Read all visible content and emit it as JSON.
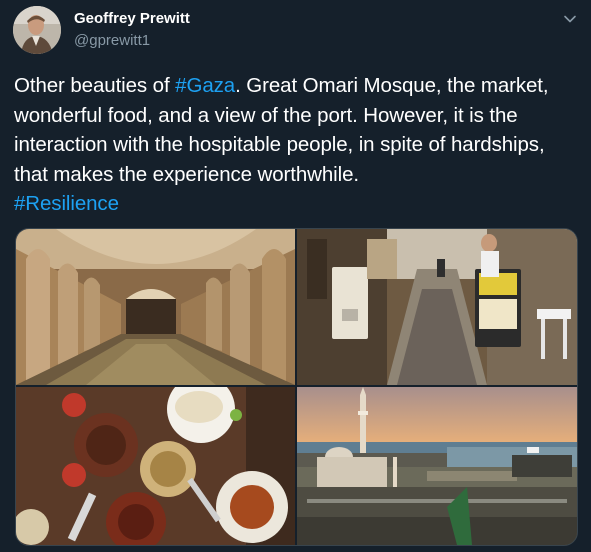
{
  "tweet": {
    "author_name": "Geoffrey Prewitt",
    "author_handle": "@gprewitt1",
    "text_before_gaza": "Other beauties of ",
    "hashtag_gaza": "#Gaza",
    "text_body": ". Great Omari Mosque, the market, wonderful food, and a view of the port. However, it is the interaction with the hospitable people, in spite of hardships, that makes the experience worthwhile.",
    "hashtag_resilience": "#Resilience"
  },
  "media": {
    "photos": [
      {
        "subject": "mosque-arcade"
      },
      {
        "subject": "market-street"
      },
      {
        "subject": "food-spread"
      },
      {
        "subject": "port-view"
      }
    ]
  },
  "colors": {
    "background": "#15202b",
    "text": "#ffffff",
    "secondary_text": "#8899a6",
    "link": "#1da1f2"
  }
}
